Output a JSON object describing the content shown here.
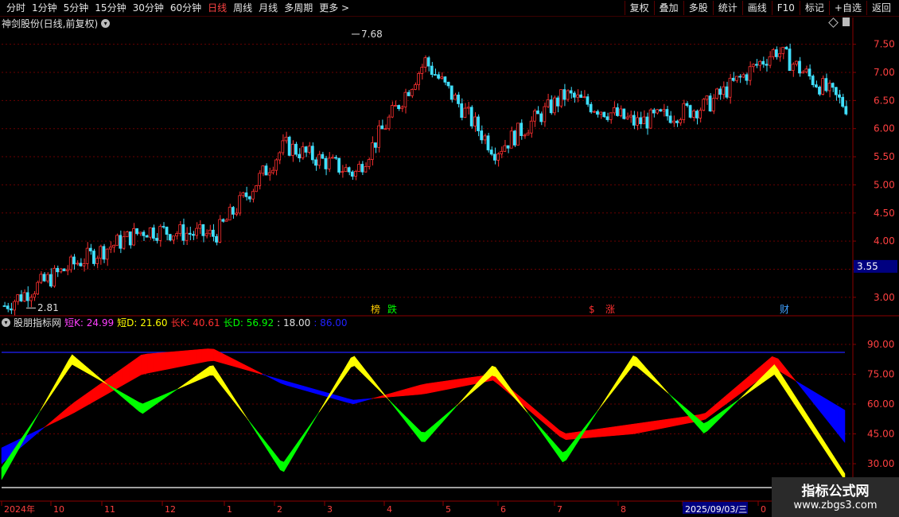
{
  "toolbar": {
    "left": [
      "分时",
      "1分钟",
      "5分钟",
      "15分钟",
      "30分钟",
      "60分钟",
      "日线",
      "周线",
      "月线",
      "多周期",
      "更多 >"
    ],
    "active": "日线",
    "right": [
      "复权",
      "叠加",
      "多股",
      "统计",
      "画线",
      "F10",
      "标记",
      "+自选",
      "返回"
    ]
  },
  "stock_title": "神剑股份(日线,前复权)",
  "price_axis": [
    "7.50",
    "7.00",
    "6.50",
    "6.00",
    "5.50",
    "5.00",
    "4.50",
    "4.00",
    "3.50",
    "3.00"
  ],
  "current_price": "3.55",
  "price_high_label": "7.68",
  "price_low_label": "2.81",
  "markers": [
    {
      "text": "榜",
      "color": "#ffcc00"
    },
    {
      "text": "跌",
      "color": "#00ff00"
    },
    {
      "text": "$",
      "color": "#ff3030"
    },
    {
      "text": "涨",
      "color": "#ff3030"
    },
    {
      "text": "财",
      "color": "#40a0ff"
    }
  ],
  "indicator": {
    "name": "股朋指标网",
    "items": [
      {
        "text": "短K: 24.99",
        "color": "#ff40ff"
      },
      {
        "text": "短D: 21.60",
        "color": "#ffff00"
      },
      {
        "text": "长K: 40.61",
        "color": "#ff3030"
      },
      {
        "text": "长D: 56.92",
        "color": "#00ff00"
      },
      {
        "text": ": 18.00",
        "color": "#e0e0e0"
      },
      {
        "text": ": 86.00",
        "color": "#2020ff"
      }
    ],
    "axis": [
      "90.00",
      "75.00",
      "60.00",
      "45.00",
      "30.00"
    ]
  },
  "date_axis": [
    "2024年",
    "10",
    "11",
    "12",
    "1",
    "2",
    "3",
    "4",
    "5",
    "6",
    "7",
    "8",
    "2025/09/03/三",
    "0"
  ],
  "watermark": {
    "title": "指标公式网",
    "url": "www.zbgs3.com"
  },
  "chart_data": [
    {
      "type": "candlestick",
      "title": "神剑股份(日线,前复权)",
      "ylim": [
        2.7,
        7.75
      ],
      "x": [
        "2024-09",
        "2024-10",
        "2024-11",
        "2024-12",
        "2025-01",
        "2025-02",
        "2025-03",
        "2025-04",
        "2025-05",
        "2025-06",
        "2025-07",
        "2025-08",
        "2025-09"
      ],
      "close": [
        2.85,
        3.6,
        4.2,
        4.1,
        5.7,
        5.2,
        7.2,
        5.6,
        6.6,
        6.1,
        6.4,
        7.4,
        6.4
      ],
      "annotations": [
        "7.68",
        "2.81"
      ]
    },
    {
      "type": "area",
      "title": "股朋指标网",
      "ylim": [
        12,
        98
      ],
      "x": [
        "2024-09",
        "2024-10",
        "2024-11",
        "2024-12",
        "2025-01",
        "2025-02",
        "2025-03",
        "2025-04",
        "2025-05",
        "2025-06",
        "2025-07",
        "2025-08",
        "2025-09"
      ],
      "series": [
        {
          "name": "短K",
          "values": [
            22,
            85,
            55,
            80,
            25,
            85,
            40,
            80,
            30,
            85,
            45,
            80,
            24.99
          ]
        },
        {
          "name": "短D",
          "values": [
            28,
            80,
            60,
            75,
            30,
            80,
            45,
            75,
            35,
            80,
            50,
            75,
            21.6
          ]
        },
        {
          "name": "长K",
          "values": [
            30,
            60,
            85,
            88,
            70,
            60,
            70,
            75,
            45,
            50,
            55,
            85,
            40.61
          ]
        },
        {
          "name": "长D",
          "values": [
            38,
            55,
            75,
            82,
            72,
            62,
            65,
            72,
            42,
            45,
            52,
            78,
            56.92
          ]
        }
      ],
      "reference_lines": [
        18,
        86
      ]
    }
  ]
}
